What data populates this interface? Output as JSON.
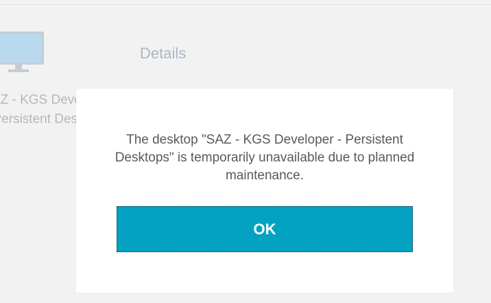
{
  "background": {
    "desktop_tile": {
      "name_line1": "SAZ - KGS Developer -",
      "name_line2": "Persistent Desktops",
      "icon": "monitor-icon"
    },
    "details_label": "Details"
  },
  "dialog": {
    "message": "The desktop \"SAZ - KGS Developer - Persistent Desktops\" is temporarily unavailable due to planned maintenance.",
    "ok_label": "OK"
  },
  "colors": {
    "page_background": "#f2f2f2",
    "dialog_background": "#ffffff",
    "button_accent": "#03a2c2",
    "message_text": "#595959",
    "details_text": "#aab6c7"
  }
}
